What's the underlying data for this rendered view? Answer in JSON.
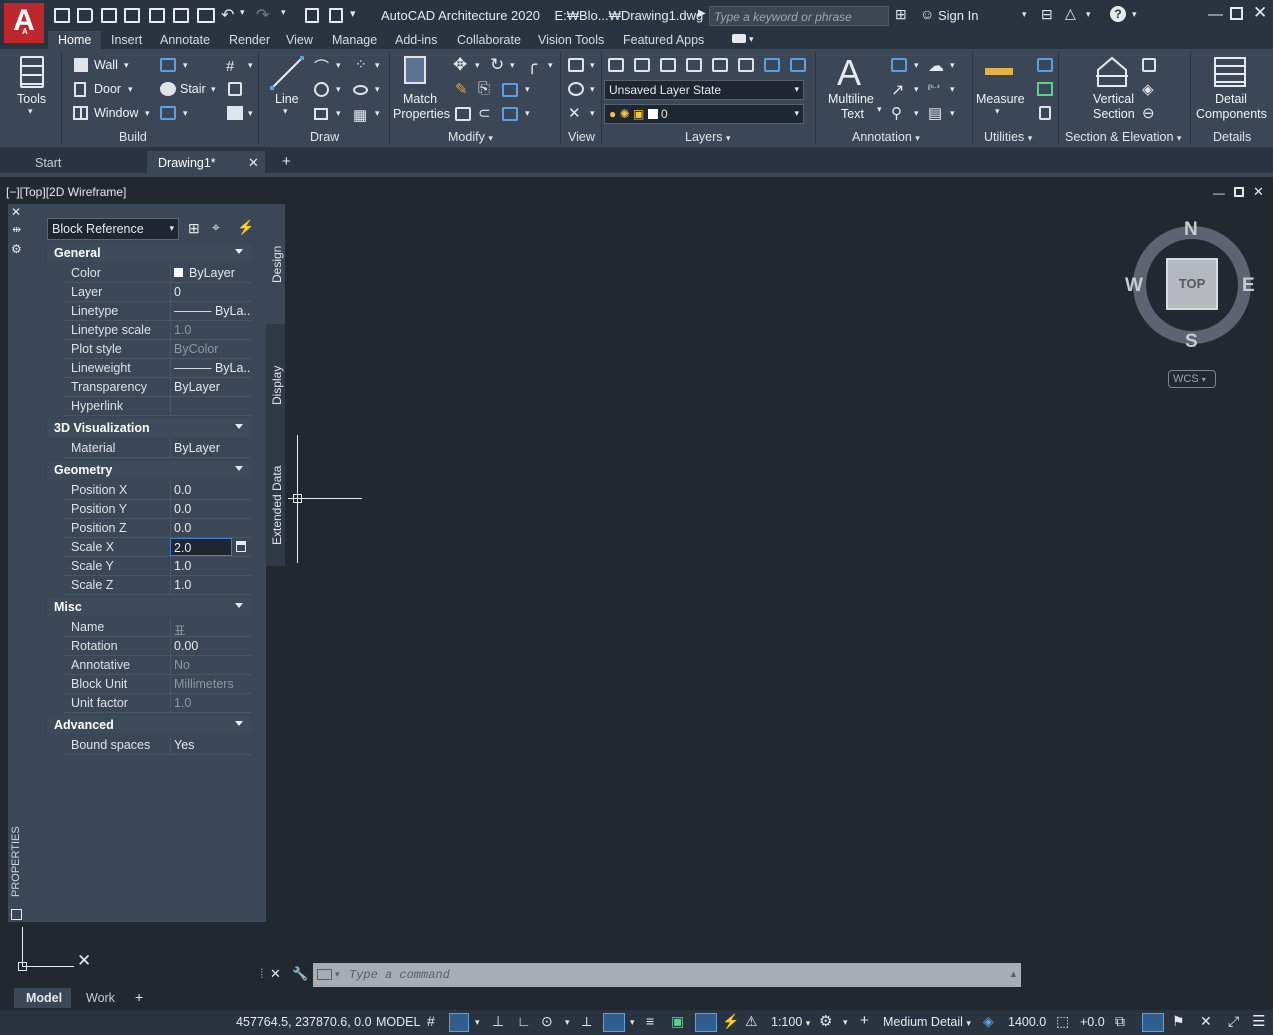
{
  "app": {
    "title": "AutoCAD Architecture 2020",
    "file": "E:₩Blo...₩Drawing1.dwg",
    "logo_letter": "A",
    "logo_sub": "A"
  },
  "search": {
    "placeholder": "Type a keyword or phrase"
  },
  "user": {
    "signin_label": "Sign In"
  },
  "ribbon_tabs": [
    "Home",
    "Insert",
    "Annotate",
    "Render",
    "View",
    "Manage",
    "Add-ins",
    "Collaborate",
    "Vision Tools",
    "Featured Apps"
  ],
  "ribbon": {
    "tools_label": "Tools",
    "build": {
      "label": "Build",
      "wall": "Wall",
      "door": "Door",
      "window": "Window",
      "stair": "Stair"
    },
    "draw": {
      "label": "Draw",
      "line": "Line"
    },
    "modify": {
      "label": "Modify",
      "match1": "Match",
      "match2": "Properties"
    },
    "view": {
      "label": "View"
    },
    "layers": {
      "label": "Layers",
      "layer_state": "Unsaved Layer State",
      "current_layer": "0"
    },
    "annotation": {
      "label": "Annotation",
      "mtext1": "Multiline",
      "mtext2": "Text"
    },
    "utilities": {
      "label": "Utilities",
      "measure": "Measure"
    },
    "section": {
      "label": "Section & Elevation",
      "vs1": "Vertical",
      "vs2": "Section"
    },
    "details": {
      "label": "Details",
      "dc1": "Detail",
      "dc2": "Components"
    }
  },
  "file_tabs": {
    "start": "Start",
    "drawing": "Drawing1*"
  },
  "viewport": {
    "label": "[−][Top][2D Wireframe]"
  },
  "properties": {
    "palette_title": "PROPERTIES",
    "object_type": "Block Reference",
    "side_tabs": [
      "Design",
      "Display",
      "Extended Data"
    ],
    "categories": {
      "general": "General",
      "viz": "3D Visualization",
      "geometry": "Geometry",
      "misc": "Misc",
      "advanced": "Advanced"
    },
    "general": [
      {
        "name": "Color",
        "value": "ByLayer"
      },
      {
        "name": "Layer",
        "value": "0"
      },
      {
        "name": "Linetype",
        "value": "——— ByLa..."
      },
      {
        "name": "Linetype scale",
        "value": "1.0"
      },
      {
        "name": "Plot style",
        "value": "ByColor"
      },
      {
        "name": "Lineweight",
        "value": "——— ByLa..."
      },
      {
        "name": "Transparency",
        "value": "ByLayer"
      },
      {
        "name": "Hyperlink",
        "value": ""
      }
    ],
    "viz": [
      {
        "name": "Material",
        "value": "ByLayer"
      }
    ],
    "geometry": [
      {
        "name": "Position X",
        "value": "0.0"
      },
      {
        "name": "Position Y",
        "value": "0.0"
      },
      {
        "name": "Position Z",
        "value": "0.0"
      },
      {
        "name": "Scale X",
        "value": "2.0"
      },
      {
        "name": "Scale Y",
        "value": "1.0"
      },
      {
        "name": "Scale Z",
        "value": "1.0"
      }
    ],
    "misc": [
      {
        "name": "Name",
        "value": "표"
      },
      {
        "name": "Rotation",
        "value": "0.00"
      },
      {
        "name": "Annotative",
        "value": "No"
      },
      {
        "name": "Block Unit",
        "value": "Millimeters"
      },
      {
        "name": "Unit factor",
        "value": "1.0"
      }
    ],
    "advanced": [
      {
        "name": "Bound spaces",
        "value": "Yes"
      }
    ]
  },
  "navcube": {
    "n": "N",
    "s": "S",
    "e": "E",
    "w": "W",
    "face": "TOP",
    "ucs": "WCS"
  },
  "command": {
    "placeholder": "Type a command"
  },
  "layout_tabs": [
    "Model",
    "Work"
  ],
  "status": {
    "coords": "457764.5, 237870.6, 0.0",
    "space": "MODEL",
    "scale": "1:100",
    "detail": "Medium Detail",
    "elevation": "1400.0",
    "offset": "+0.0"
  }
}
